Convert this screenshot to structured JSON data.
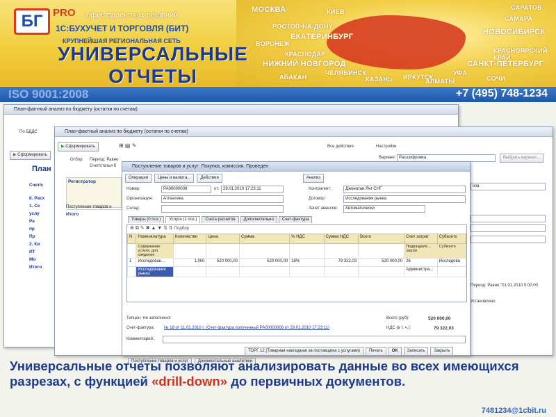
{
  "header": {
    "logo_letters": "БГ",
    "logo_pro": "PRO",
    "office_line": "офис проектных решений",
    "company_line": "1С:БУХУЧЕТ И ТОРГОВЛЯ (БИТ)",
    "network_line": "КРУПНЕЙШАЯ РЕГИОНАЛЬНАЯ СЕТЬ",
    "title_line1": "УНИВЕРСАЛЬНЫЕ",
    "title_line2": "ОТЧЕТЫ",
    "cities": [
      "МОСКВА",
      "КИЕВ",
      "РОСТОВ-НА-ДОНУ",
      "САРАТОВ",
      "САМАРА",
      "НОВОСИБИРСК",
      "ЕКАТЕРИНБУРГ",
      "ВОРОНЕЖ",
      "КРАСНОДАР",
      "КРАСНОЯРСКИЙ КРАЙ",
      "НИЖНИЙ НОВГОРОД",
      "САНКТ-ПЕТЕРБУРГ",
      "ЧЕЛЯБИНСК",
      "АБАКАН",
      "КАЗАНЬ",
      "ИРКУТСК",
      "УФА",
      "СОЧИ",
      "АЛМАТЫ"
    ],
    "iso": "ISO 9001:2008",
    "phone": "+7 (495) 748-1234"
  },
  "back_window": {
    "title": "План-фактный анализ по бюджету (остатки по счетам)",
    "left_label": "По БДДС",
    "run_button": "Сформировать",
    "heading": "План",
    "rows": [
      "Счет/с",
      "II. Расх",
      "1. Се",
      "услу",
      "Ра",
      "пр",
      "Пр",
      "2. Ки",
      "ИТ",
      "Мо",
      "Итого"
    ]
  },
  "mid_window": {
    "title": "План-фактный анализ по бюджету (остатки по счетам)",
    "run_button": "Сформировать",
    "all_actions": "Все действия",
    "settings": "Настройки",
    "variant_label": "Вариант:",
    "variant_value": "Расшифровка",
    "choose_variant": "Выбрать вариант...",
    "selection_label": "Отбор",
    "period_text": "Период: Равно",
    "accounts_text": "Счет/статья б",
    "registrar_header": "Регистратор",
    "doc_row": "Поступление товаров и",
    "total_row": "Итого",
    "right_fields": [
      "нза",
      "",
      "",
      ""
    ],
    "right_period": "Период: Равно \"01.01.2010 0:00:00",
    "right_installed": "Установлено"
  },
  "doc_window": {
    "title": "Поступление товаров и услуг: Покупка, комиссия. Проведен",
    "toolbar": [
      "Операция",
      "Цены и валюта...",
      "Действия",
      "Анализ"
    ],
    "number_label": "Номер:",
    "number_value": "РА00000008",
    "from_label": "от:",
    "date_value": "29.01.2010 17:23:11",
    "counterparty_label": "Контрагент:",
    "counterparty_value": "Джонатан Янг СНГ",
    "org_label": "Организация:",
    "org_value": "Атлантика",
    "contract_label": "Договор:",
    "contract_value": "Исследования рынка",
    "warehouse_label": "Склад:",
    "warehouse_value": "",
    "offset_label": "Зачет авансов:",
    "offset_value": "Автоматически",
    "tabs": [
      "Товары (0 поз.)",
      "Услуги (1 поз.)",
      "Счета расчетов",
      "Дополнительно",
      "Счет-фактура"
    ],
    "selection": "Подбор",
    "columns": [
      "N",
      "Номенклатура",
      "Количество",
      "Цена",
      "Сумма",
      "% НДС",
      "Сумма НДС",
      "Всего",
      "Счет затрат",
      "Субконто"
    ],
    "subcolumns": [
      "Содержание услуги, доп. сведения",
      "Подразделе... затрат",
      "Субконто"
    ],
    "row": {
      "n": "1",
      "item": "Исследован...",
      "qty": "1,000",
      "price": "520 000,00",
      "sum": "520 000,00",
      "vat_rate": "18%",
      "vat_sum": "79 322,03",
      "total": "520 000,00",
      "account": "26",
      "subconto": "Исследова",
      "content": "Исследования рынка",
      "dept": "Администра..."
    },
    "price_type_label": "Типцен: Не заполнено!",
    "total_label": "Всего (руб):",
    "total_value": "520 000,00",
    "vat_label": "НДС (в т. ч.):",
    "vat_value": "79 322,03",
    "invoice_label": "Счет-фактура:",
    "invoice_value": "№ 18 от 11.01.2010 г. (Счет-фактура полученный РА00000008 от 29.01.2010 17:23:11)",
    "comment_label": "Комментарий:",
    "bottom_buttons": [
      "ТОРГ 12 (Товарная накладная за поставщика с услугами)",
      "Печать",
      "OK",
      "Записать",
      "Закрыть"
    ]
  },
  "taskbar_tabs": [
    "Поступление товаров и услуг",
    "Документальные аналитики"
  ],
  "caption": {
    "part1": "Универсальные отчеты позволяют анализировать данные во всех имеющихся разрезах, с функцией ",
    "highlight": "«drill-down»",
    "part2": " до первичных документов."
  },
  "email": "7481234@1cbit.ru",
  "colors": {
    "title_blue": "#1d3a8c",
    "accent_red": "#d0311e",
    "strip_blue": "#1f56a8",
    "header_yellow": "#f1cc3a"
  }
}
